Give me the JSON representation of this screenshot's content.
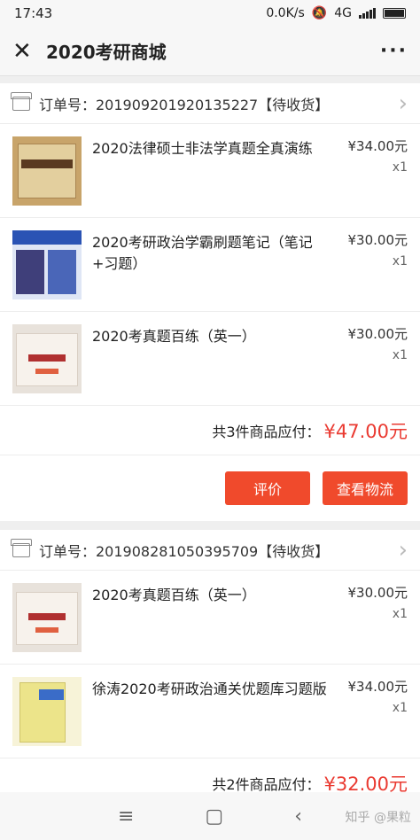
{
  "status": {
    "time": "17:43",
    "speed": "0.0K/s",
    "network": "4G"
  },
  "nav": {
    "title": "2020考研商城",
    "more": "···"
  },
  "orders": [
    {
      "header": "订单号：20190920192013522​7【待收货】",
      "items": [
        {
          "title": "2020法律硕士非法学真题全真演练",
          "price": "¥34.00元",
          "qty": "x1",
          "cover": "law"
        },
        {
          "title": "2020考研政治学霸刷题笔记（笔记+习题）",
          "price": "¥30.00元",
          "qty": "x1",
          "cover": "politics"
        },
        {
          "title": "2020考真题百练（英一）",
          "price": "¥30.00元",
          "qty": "x1",
          "cover": "english"
        }
      ],
      "summary_label": "共3件商品应付：",
      "summary_amount": "¥47.00元",
      "actions": [
        "评价",
        "查看物流"
      ]
    },
    {
      "header": "订单号：201908281050395709【待收货】",
      "items": [
        {
          "title": "2020考真题百练（英一）",
          "price": "¥30.00元",
          "qty": "x1",
          "cover": "english"
        },
        {
          "title": "徐涛2020考研政治通关优题库习题版",
          "price": "¥34.00元",
          "qty": "x1",
          "cover": "xutao"
        }
      ],
      "summary_label": "共2件商品应付：",
      "summary_amount": "¥32.00元"
    }
  ],
  "bottom_nav": {
    "menu": "≡",
    "home": "▢",
    "back": "‹"
  },
  "watermark": "知乎 @果粒"
}
